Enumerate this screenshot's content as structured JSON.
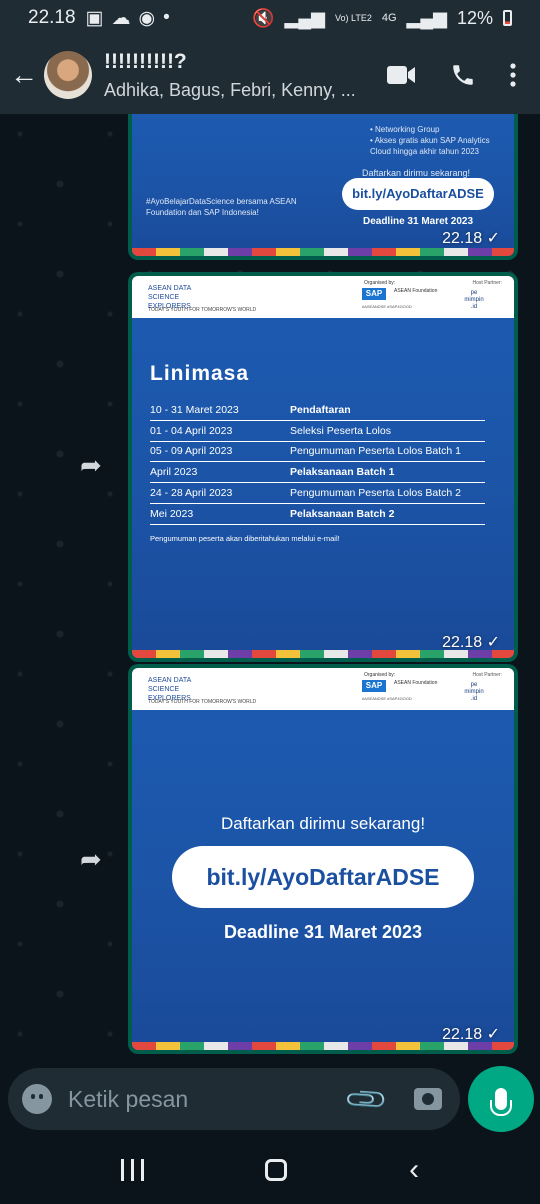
{
  "status_bar": {
    "time": "22.18",
    "signal_text": "Vo) LTE2",
    "network": "4G",
    "battery": "12%"
  },
  "header": {
    "title": "!!!!!!!!!!?",
    "subtitle": "Adhika, Bagus, Febri, Kenny, ..."
  },
  "messages": [
    {
      "time": "22.18",
      "bullets": [
        "Networking Group",
        "Akses gratis akun SAP Analytics Cloud hingga akhir tahun 2023"
      ],
      "left_text": "#AyoBelajarDataScience bersama ASEAN Foundation dan SAP Indonesia!",
      "cta": "Daftarkan dirimu sekarang!",
      "link": "bit.ly/AyoDaftarADSE",
      "deadline": "Deadline 31 Maret 2023"
    },
    {
      "time": "22.18",
      "header": {
        "adse_logo": "ASEAN DATA SCIENCE EXPLORERS",
        "tagline": "TODAY'S YOUTH FOR TOMORROW'S WORLD",
        "organized_by": "Organised by:",
        "sap": "SAP",
        "asean_foundation": "ASEAN Foundation",
        "hashtags": "#ASEANDSE #SAP4GOOD",
        "host_partner": "Host Partner:",
        "host_logo": "pe mimpin .id"
      },
      "title": "Linimasa",
      "rows": [
        {
          "date": "10 - 31 Maret 2023",
          "event": "Pendaftaran",
          "bold": true
        },
        {
          "date": "01 - 04 April 2023",
          "event": "Seleksi Peserta Lolos",
          "bold": false
        },
        {
          "date": "05 - 09 April 2023",
          "event": "Pengumuman Peserta Lolos Batch 1",
          "bold": false
        },
        {
          "date": "April 2023",
          "event": "Pelaksanaan Batch 1",
          "bold": true
        },
        {
          "date": "24 - 28 April 2023",
          "event": "Pengumuman Peserta Lolos Batch 2",
          "bold": false
        },
        {
          "date": "Mei 2023",
          "event": "Pelaksanaan Batch 2",
          "bold": true
        }
      ],
      "note": "Pengumuman peserta akan diberitahukan melalui e-mail!"
    },
    {
      "time": "22.18",
      "cta": "Daftarkan dirimu sekarang!",
      "link": "bit.ly/AyoDaftarADSE",
      "deadline": "Deadline 31 Maret 2023"
    }
  ],
  "input": {
    "placeholder": "Ketik pesan"
  },
  "icons": [
    "back-arrow-icon",
    "video-call-icon",
    "phone-icon",
    "more-icon",
    "forward-icon",
    "emoji-icon",
    "attach-icon",
    "camera-icon",
    "mic-icon"
  ]
}
